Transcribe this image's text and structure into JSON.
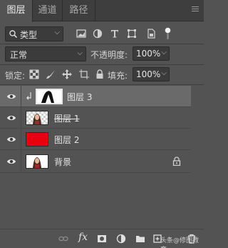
{
  "tabs": [
    {
      "label": "图层",
      "active": true
    },
    {
      "label": "通道",
      "active": false
    },
    {
      "label": "路径",
      "active": false
    }
  ],
  "filter": {
    "kind_label": "类型",
    "icons": [
      "pixel-filter-icon",
      "adjustment-filter-icon",
      "type-filter-icon",
      "shape-filter-icon",
      "smart-object-filter-icon",
      "filter-toggle-icon"
    ]
  },
  "blend": {
    "mode": "正常",
    "opacity_label": "不透明度:",
    "opacity_value": "100%"
  },
  "lock": {
    "label": "锁定:",
    "icons": [
      "lock-transparent-pixels-icon",
      "lock-image-pixels-icon",
      "lock-position-icon",
      "lock-artboard-icon",
      "lock-all-icon"
    ],
    "fill_label": "填充:",
    "fill_value": "100%"
  },
  "layers": [
    {
      "name": "图层 3",
      "visible": true,
      "selected": true,
      "clipped": true,
      "thumb": "mask-silhouette"
    },
    {
      "name": "图层 1",
      "visible": true,
      "selected": false,
      "clipped": false,
      "thumb": "portrait-transparent"
    },
    {
      "name": "图层 2",
      "visible": true,
      "selected": false,
      "clipped": false,
      "thumb": "red-fill"
    },
    {
      "name": "背景",
      "visible": true,
      "selected": false,
      "clipped": false,
      "thumb": "portrait",
      "locked": true
    }
  ],
  "colors": {
    "panel_bg": "#535353",
    "selected_row": "#6a6a6a",
    "red_layer": "#e8000e"
  },
  "footer": {
    "icons": [
      "link-layers-icon",
      "fx-icon",
      "add-mask-icon",
      "adjustment-layer-icon",
      "group-icon",
      "new-layer-icon",
      "delete-layer-icon"
    ],
    "fx_label": "fx",
    "watermark": "头条@修图教育"
  }
}
